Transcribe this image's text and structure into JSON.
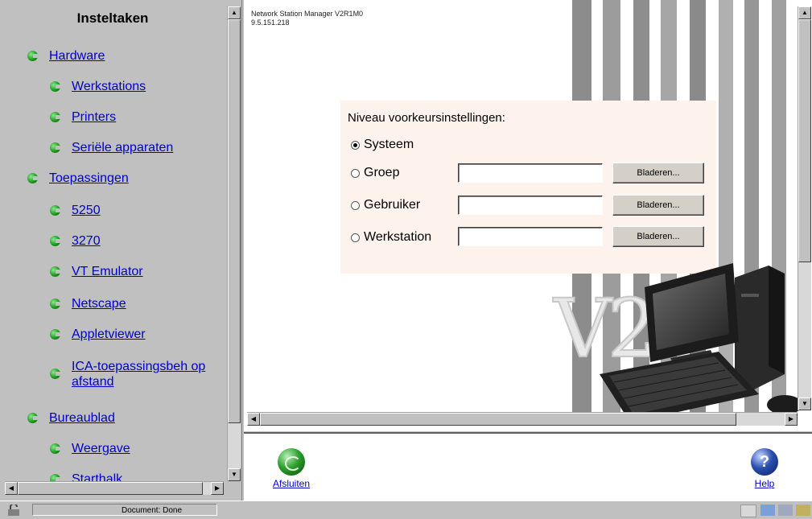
{
  "nav": {
    "title": "Insteltaken",
    "items": [
      {
        "label": "Hardware",
        "level": 0
      },
      {
        "label": "Werkstations",
        "level": 1
      },
      {
        "label": "Printers",
        "level": 1
      },
      {
        "label": "Seriële apparaten",
        "level": 1
      },
      {
        "label": "Toepassingen",
        "level": 0
      },
      {
        "label": "5250",
        "level": 1
      },
      {
        "label": "3270",
        "level": 1
      },
      {
        "label": "VT Emulator",
        "level": 1
      },
      {
        "label": "Netscape",
        "level": 1
      },
      {
        "label": "Appletviewer",
        "level": 1
      },
      {
        "label": "ICA-toepassingsbeh op afstand",
        "level": 1
      },
      {
        "label": "Bureaublad",
        "level": 0
      },
      {
        "label": "Weergave",
        "level": 1
      },
      {
        "label": "Starthalk",
        "level": 1
      }
    ]
  },
  "header": {
    "app_name": "Network Station Manager V2R1M0",
    "ip": "9.5.151.218"
  },
  "prefs": {
    "title": "Niveau voorkeursinstellingen:",
    "options": [
      {
        "label": "Systeem",
        "checked": true
      },
      {
        "label": "Groep",
        "checked": false,
        "browse_label": "Bladeren..."
      },
      {
        "label": "Gebruiker",
        "checked": false,
        "browse_label": "Bladeren..."
      },
      {
        "label": "Werkstation",
        "checked": false,
        "browse_label": "Bladeren..."
      }
    ]
  },
  "branding": {
    "mark": "V2"
  },
  "toolbar": {
    "exit_label": "Afsluiten",
    "help_label": "Help"
  },
  "status": {
    "text": "Document: Done"
  },
  "colors": {
    "link": "#0000c8",
    "bullet": "#1e9a1e",
    "panel": "#fdf3ec"
  }
}
